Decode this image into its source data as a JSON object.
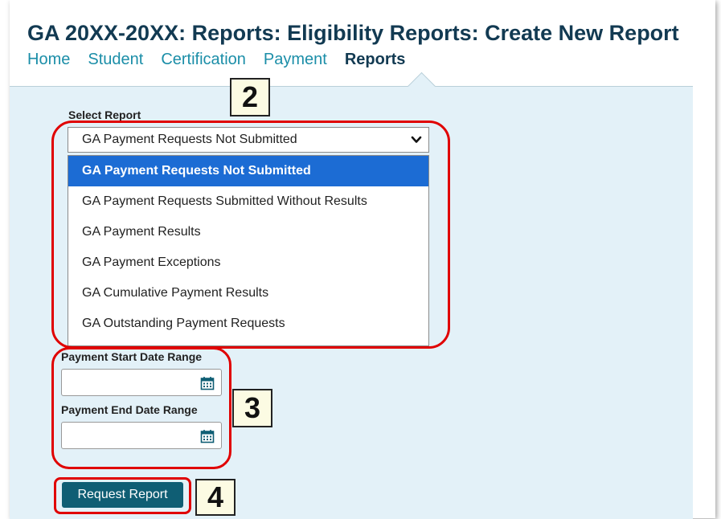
{
  "header": {
    "title": "GA 20XX-20XX: Reports: Eligibility Reports: Create New Report",
    "nav": [
      "Home",
      "Student",
      "Certification",
      "Payment",
      "Reports"
    ],
    "active_nav": "Reports"
  },
  "form": {
    "select_report_label": "Select Report",
    "selected_report": "GA Payment Requests Not Submitted",
    "report_options": [
      "GA Payment Requests Not Submitted",
      "GA Payment Requests Submitted Without Results",
      "GA Payment Results",
      "GA Payment Exceptions",
      "GA Cumulative Payment Results",
      "GA Outstanding Payment Requests"
    ],
    "start_date_label": "Payment Start Date Range",
    "start_date_value": "",
    "end_date_label": "Payment End Date Range",
    "end_date_value": "",
    "submit_label": "Request Report"
  },
  "callouts": [
    "2",
    "3",
    "4"
  ],
  "colors": {
    "title": "#123a52",
    "nav_link": "#1b8ea8",
    "panel_bg": "#e3f1f8",
    "option_highlight": "#1c6cd4",
    "button_bg": "#0f5e74",
    "annotation_red": "#e00000"
  },
  "icons": [
    "chevron-down-icon",
    "calendar-icon"
  ]
}
